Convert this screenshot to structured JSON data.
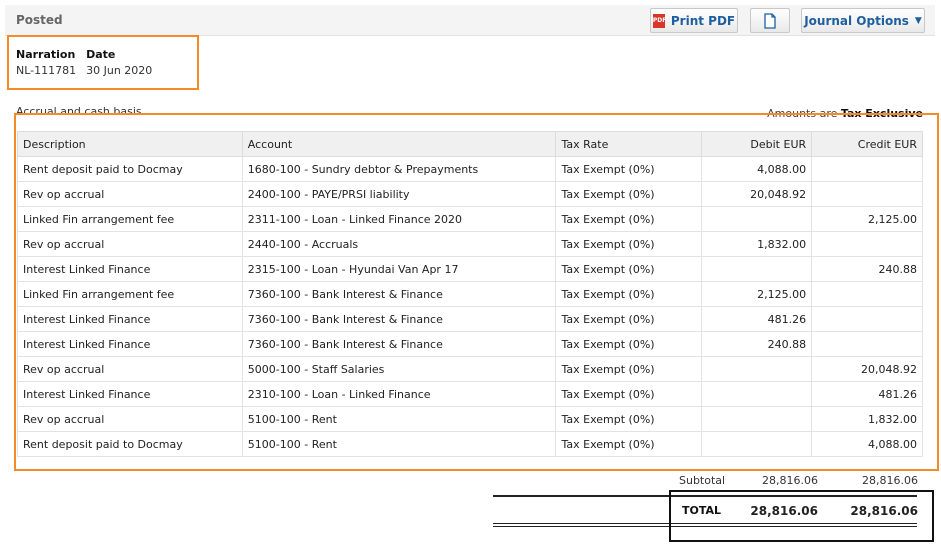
{
  "header": {
    "status": "Posted",
    "print_pdf": "Print PDF",
    "pdf_icon_text": "PDF",
    "journal_options": "Journal Options"
  },
  "meta": {
    "narration_label": "Narration",
    "date_label": "Date",
    "narration_value": "NL-111781",
    "date_value": "30 Jun 2020"
  },
  "basis": "Accrual and cash basis",
  "amounts": {
    "prefix": "Amounts are",
    "value": "Tax Exclusive"
  },
  "table": {
    "columns": [
      "Description",
      "Account",
      "Tax Rate",
      "Debit EUR",
      "Credit EUR"
    ],
    "rows": [
      {
        "desc": "Rent deposit paid to Docmay",
        "account": "1680-100 - Sundry debtor & Prepayments",
        "tax": "Tax Exempt (0%)",
        "debit": "4,088.00",
        "credit": ""
      },
      {
        "desc": "Rev op accrual",
        "account": "2400-100 - PAYE/PRSI liability",
        "tax": "Tax Exempt (0%)",
        "debit": "20,048.92",
        "credit": ""
      },
      {
        "desc": "Linked Fin arrangement fee",
        "account": "2311-100 - Loan - Linked Finance 2020",
        "tax": "Tax Exempt (0%)",
        "debit": "",
        "credit": "2,125.00"
      },
      {
        "desc": "Rev op accrual",
        "account": "2440-100 - Accruals",
        "tax": "Tax Exempt (0%)",
        "debit": "1,832.00",
        "credit": ""
      },
      {
        "desc": "Interest Linked Finance",
        "account": "2315-100 - Loan - Hyundai Van Apr 17",
        "tax": "Tax Exempt (0%)",
        "debit": "",
        "credit": "240.88"
      },
      {
        "desc": "Linked Fin arrangement fee",
        "account": "7360-100 - Bank Interest & Finance",
        "tax": "Tax Exempt (0%)",
        "debit": "2,125.00",
        "credit": ""
      },
      {
        "desc": "Interest Linked Finance",
        "account": "7360-100 - Bank Interest & Finance",
        "tax": "Tax Exempt (0%)",
        "debit": "481.26",
        "credit": ""
      },
      {
        "desc": "Interest Linked Finance",
        "account": "7360-100 - Bank Interest & Finance",
        "tax": "Tax Exempt (0%)",
        "debit": "240.88",
        "credit": ""
      },
      {
        "desc": "Rev op accrual",
        "account": "5000-100 - Staff Salaries",
        "tax": "Tax Exempt (0%)",
        "debit": "",
        "credit": "20,048.92"
      },
      {
        "desc": "Interest Linked Finance",
        "account": "2310-100 - Loan - Linked Finance",
        "tax": "Tax Exempt (0%)",
        "debit": "",
        "credit": "481.26"
      },
      {
        "desc": "Rev op accrual",
        "account": "5100-100 - Rent",
        "tax": "Tax Exempt (0%)",
        "debit": "",
        "credit": "1,832.00"
      },
      {
        "desc": "Rent deposit paid to Docmay",
        "account": "5100-100 - Rent",
        "tax": "Tax Exempt (0%)",
        "debit": "",
        "credit": "4,088.00"
      }
    ]
  },
  "totals": {
    "subtotal_label": "Subtotal",
    "subtotal_debit": "28,816.06",
    "subtotal_credit": "28,816.06",
    "total_label": "TOTAL",
    "total_debit": "28,816.06",
    "total_credit": "28,816.06"
  },
  "colors": {
    "highlight": "#f28c28",
    "link": "#1f5fa0",
    "pdf_icon": "#d9362b"
  },
  "icons": {
    "print": "pdf-icon",
    "copy": "copy-icon",
    "dropdown": "chevron-down-icon"
  }
}
